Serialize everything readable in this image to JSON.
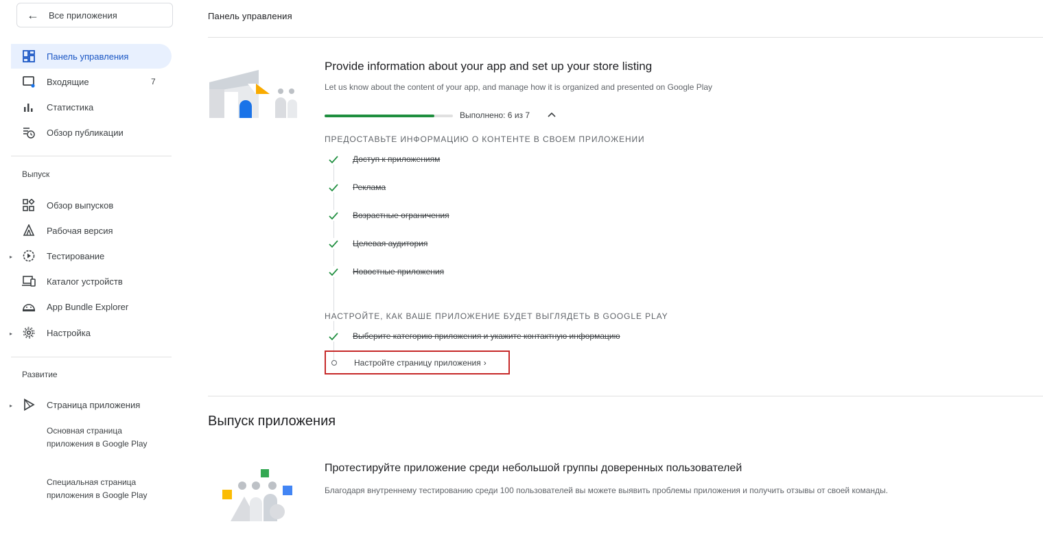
{
  "sidebar": {
    "back_label": "Все приложения",
    "items_top": [
      {
        "label": "Панель управления",
        "icon": "dashboard-icon",
        "active": true
      },
      {
        "label": "Входящие",
        "icon": "inbox-icon",
        "badge": "7"
      },
      {
        "label": "Статистика",
        "icon": "bar-chart-icon"
      },
      {
        "label": "Обзор публикации",
        "icon": "publishing-overview-icon"
      }
    ],
    "release_section": "Выпуск",
    "items_release": [
      {
        "label": "Обзор выпусков",
        "icon": "releases-overview-icon"
      },
      {
        "label": "Рабочая версия",
        "icon": "production-icon"
      },
      {
        "label": "Тестирование",
        "icon": "testing-icon"
      },
      {
        "label": "Каталог устройств",
        "icon": "device-catalog-icon"
      },
      {
        "label": "App Bundle Explorer",
        "icon": "bundle-explorer-icon"
      },
      {
        "label": "Настройка",
        "icon": "settings-gear-icon"
      }
    ],
    "growth_section": "Развитие",
    "items_growth": [
      {
        "label": "Страница приложения",
        "icon": "play-store-icon"
      }
    ],
    "sub_items": [
      "Основная страница приложения в Google Play",
      "Специальная страница приложения в Google Play"
    ]
  },
  "main": {
    "page_title": "Панель управления",
    "setup_card": {
      "title": "Provide information about your app and set up your store listing",
      "subtitle": "Let us know about the content of your app, and manage how it is organized and presented on Google Play",
      "progress_label": "Выполнено: 6 из 7",
      "progress_fraction": 0.857,
      "group1_title": "ПРЕДОСТАВЬТЕ ИНФОРМАЦИЮ О КОНТЕНТЕ В СВОЕМ ПРИЛОЖЕНИИ",
      "group1_tasks": [
        "Доступ к приложениям",
        "Реклама",
        "Возрастные ограничения",
        "Целевая аудитория",
        "Новостные приложения"
      ],
      "group2_title": "НАСТРОЙТЕ, КАК ВАШЕ ПРИЛОЖЕНИЕ БУДЕТ ВЫГЛЯДЕТЬ В GOOGLE PLAY",
      "group2_done_task": "Выберите категорию приложения и укажите контактную информацию",
      "group2_open_task": "Настройте страницу приложения",
      "open_task_chevron": "›"
    },
    "release_section_title": "Выпуск приложения",
    "test_card": {
      "title": "Протестируйте приложение среди небольшой группы доверенных пользователей",
      "subtitle": "Благодаря внутреннему тестированию среди 100 пользователей вы можете выявить проблемы приложения и получить отзывы от своей команды."
    }
  },
  "colors": {
    "accent": "#1a56c4",
    "active_bg": "#e8f0fe",
    "progress": "#1e8e3e",
    "check": "#1e8e3e",
    "highlight_border": "#c62828"
  }
}
